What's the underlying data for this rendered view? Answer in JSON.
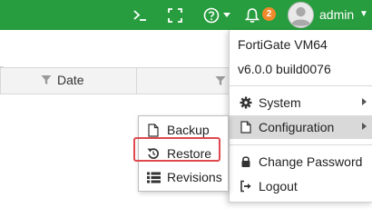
{
  "topbar": {
    "bg_color": "#289d3f",
    "cli_icon": "terminal-icon",
    "fullscreen_icon": "fullscreen-icon",
    "help_icon": "help-icon",
    "notifications": {
      "icon": "bell-icon",
      "count": "2",
      "badge_color": "#f0892a"
    },
    "user": {
      "name": "admin",
      "avatar_icon": "user-avatar-icon"
    }
  },
  "table": {
    "date_header": "Date"
  },
  "user_menu": {
    "product": "FortiGate VM64",
    "version": "v6.0.0 build0076",
    "items": [
      {
        "label": "System",
        "icon": "gear-icon",
        "has_submenu": true
      },
      {
        "label": "Configuration",
        "icon": "file-icon",
        "has_submenu": true,
        "active": true
      },
      {
        "label": "Change Password",
        "icon": "lock-icon"
      },
      {
        "label": "Logout",
        "icon": "logout-icon"
      }
    ]
  },
  "config_submenu": {
    "items": [
      {
        "label": "Backup",
        "icon": "file-icon"
      },
      {
        "label": "Restore",
        "icon": "restore-icon",
        "highlighted": true
      },
      {
        "label": "Revisions",
        "icon": "list-icon"
      }
    ],
    "highlight_color": "#e0484e"
  }
}
